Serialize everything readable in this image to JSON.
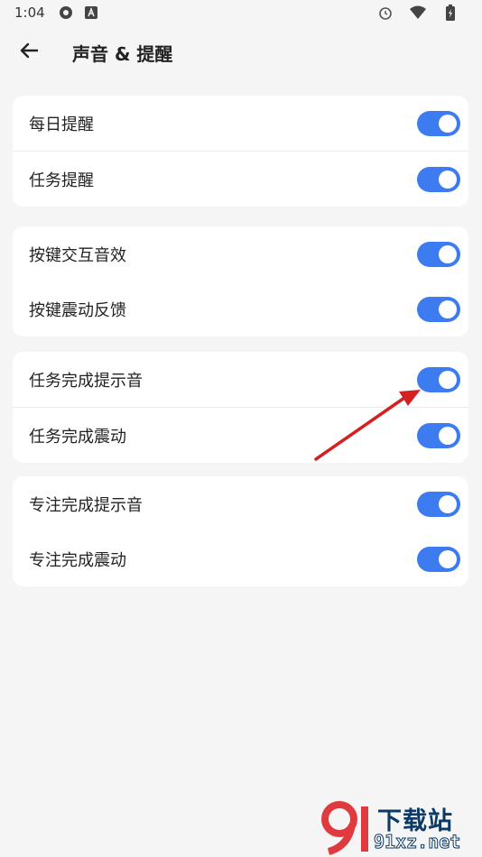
{
  "status_bar": {
    "time": "1:04",
    "left_icons": [
      "settings-icon",
      "a-badge-icon"
    ],
    "right_icons": [
      "alarm-icon",
      "wifi-icon",
      "battery-icon"
    ]
  },
  "header": {
    "back_icon": "arrow-left-icon",
    "title": "声音 & 提醒"
  },
  "colors": {
    "background": "#f5f5f5",
    "card": "#ffffff",
    "toggle_on": "#3d7cf0",
    "annotation_arrow": "#d42020"
  },
  "groups": [
    {
      "items": [
        {
          "label": "每日提醒",
          "enabled": true
        },
        {
          "label": "任务提醒",
          "enabled": true
        }
      ]
    },
    {
      "items": [
        {
          "label": "按键交互音效",
          "enabled": true
        },
        {
          "label": "按键震动反馈",
          "enabled": true
        }
      ]
    },
    {
      "items": [
        {
          "label": "任务完成提示音",
          "enabled": true
        },
        {
          "label": "任务完成震动",
          "enabled": true
        }
      ]
    },
    {
      "items": [
        {
          "label": "专注完成提示音",
          "enabled": true
        },
        {
          "label": "专注完成震动",
          "enabled": true
        }
      ]
    }
  ],
  "watermark": {
    "text": "下载站",
    "domain": "91xz.net"
  }
}
